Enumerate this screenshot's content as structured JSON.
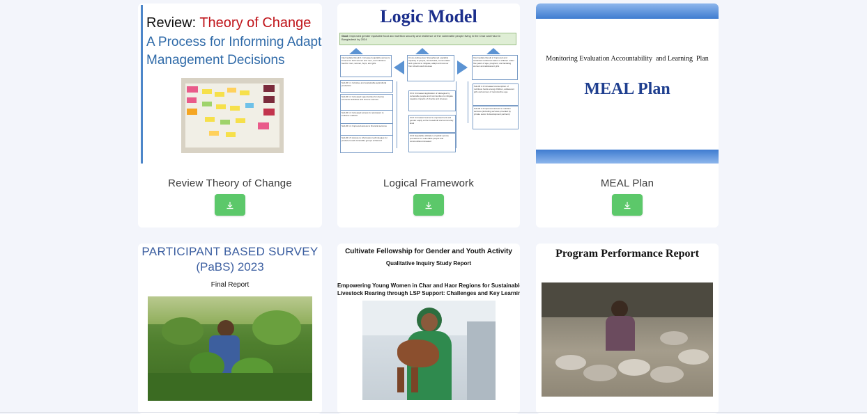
{
  "cards": [
    {
      "title": "Review Theory of Change",
      "thumb": {
        "heading_prefix": "Review: ",
        "heading_emphasis": "Theory of Change",
        "subtitle_line1": "A Process for Informing Adaptive",
        "subtitle_line2": "Management Decisions"
      }
    },
    {
      "title": "Logical Framework",
      "thumb": {
        "heading": "Logic Model",
        "goal_label": "Goal:",
        "goal_text": "Improved gender equitable food and nutrition security and resilience of the vulnerable people living in the Char and Haor in Bangladesh by 2024",
        "ir1": "Intermediate Result 1: Increased equitable access to income for both women and men, and nutritious food for men, women, boys, and girls",
        "cc": "Cross-cutting area: Strengthened equitable capacity of people, households, communities and systems to mitigate, adapt and recover from shocks and stresses",
        "ir2": "Intermediate Result 2: Improved and sustained nutritional status of children under five years of age, pregnant, and lactating women and adolescent girls",
        "sub11": "Sub-IR 1.1 Inclusive and sustainable agricultural production",
        "sub12": "Sub-IR 1.2 Increased opportunities for diverse economic activities and income sources",
        "sub13": "Sub-IR 1.3 Increased access for producers to inclusive markets",
        "sub14": "Sub-IR 1.4 Improved access to financial services",
        "sub15": "Sub-IR 1.5 Access to information technologies for producers and vulnerable groups enhanced",
        "cc1": "CC1: Increased application of strategies by vulnerable people and communities to mitigate negative impacts of shocks and stresses",
        "cc2": "CC2: Increased women's empowerment and gender equity at the household and community level",
        "cc3": "CC3: Equitable utilization of public service provisions for vulnerable people and communities increased",
        "sub21": "Sub-IR 2.1 Increased consumption of nutritious foods among children, adolescent girls and women of reproductive age",
        "sub22": "Sub-IR 2.2 Improved access to nutrition services (including services provided by private sector & development partners)"
      }
    },
    {
      "title": "MEAL Plan",
      "thumb": {
        "subtitle": "Monitoring Evaluation Accountability  and Learning  Plan",
        "heading": "MEAL Plan"
      }
    },
    {
      "title": "",
      "thumb": {
        "heading_line1": "PARTICIPANT BASED SURVEY",
        "heading_line2": "(PaBS) 2023",
        "subtitle": "Final Report"
      }
    },
    {
      "title": "",
      "thumb": {
        "heading": "Cultivate Fellowship for Gender and Youth Activity",
        "subheading": "Qualitative Inquiry Study Report",
        "body_line1": "Empowering Young Women in Char and Haor Regions for Sustainable",
        "body_line2": "Livestock Rearing through LSP Support: Challenges and Key Learnings"
      }
    },
    {
      "title": "",
      "thumb": {
        "heading": "Program Performance Report"
      }
    }
  ],
  "icons": {
    "download": "download-icon"
  },
  "colors": {
    "download_button": "#5cc86a",
    "toc_red": "#c0151b",
    "toc_blue": "#2f6aa8",
    "meal_blue": "#1f3f8f",
    "pabs_blue": "#3b5ea0",
    "logic_blue": "#1c2f8c"
  }
}
